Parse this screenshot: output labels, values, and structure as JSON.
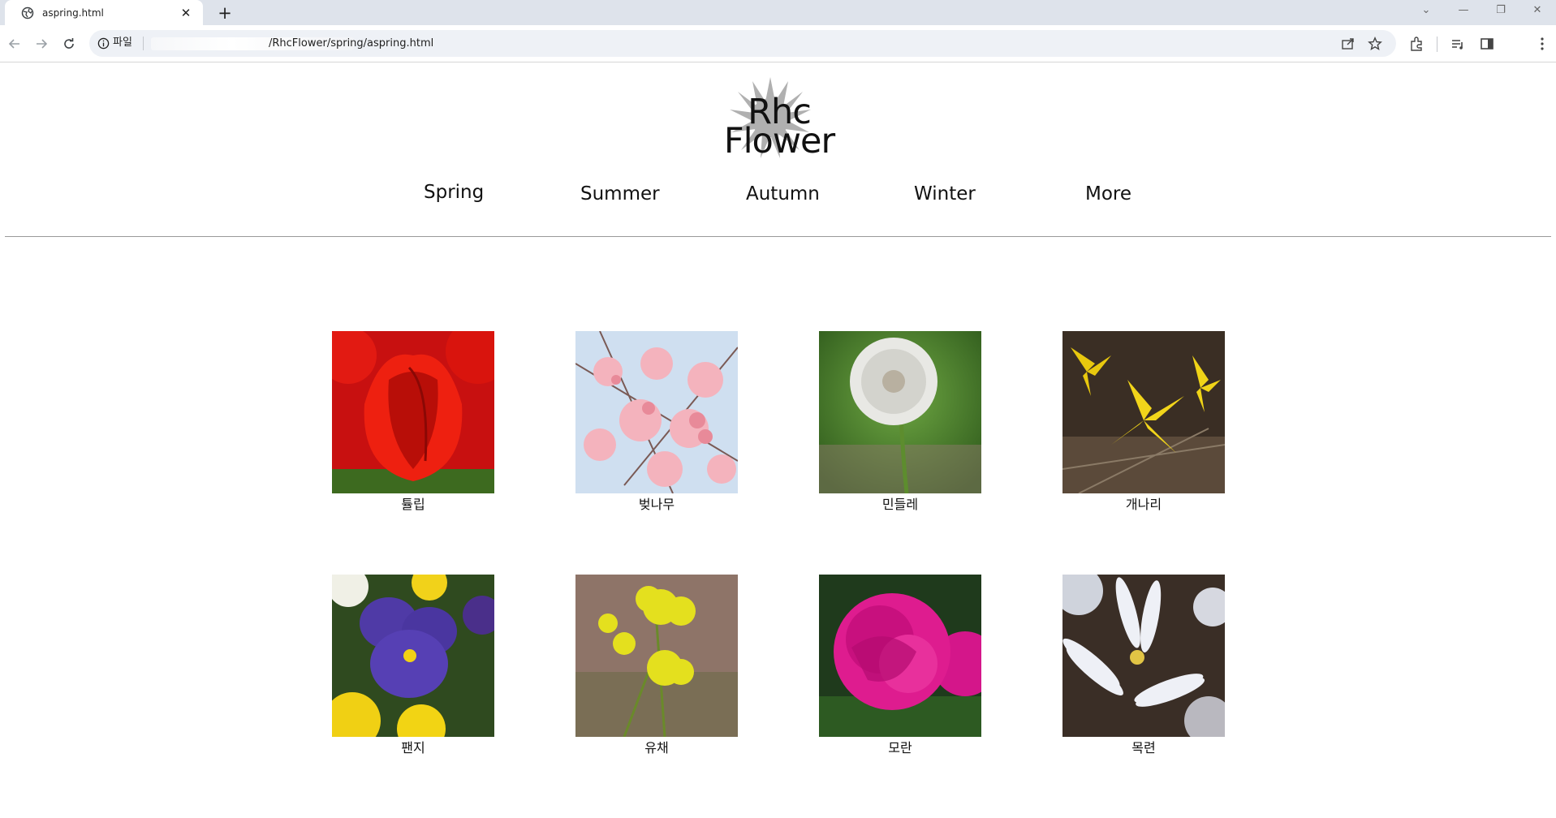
{
  "browser": {
    "tab_title": "aspring.html",
    "address_chip": "파일",
    "url": "/RhcFlower/spring/aspring.html"
  },
  "site": {
    "logo_line1": "Rhc",
    "logo_line2": "Flower"
  },
  "nav": {
    "items": [
      {
        "label": "Spring"
      },
      {
        "label": "Summer"
      },
      {
        "label": "Autumn"
      },
      {
        "label": "Winter"
      },
      {
        "label": "More"
      }
    ]
  },
  "gallery": {
    "items": [
      {
        "caption": "튤립"
      },
      {
        "caption": "벚나무"
      },
      {
        "caption": "민들레"
      },
      {
        "caption": "개나리"
      },
      {
        "caption": "팬지"
      },
      {
        "caption": "유채"
      },
      {
        "caption": "모란"
      },
      {
        "caption": "목련"
      }
    ]
  }
}
